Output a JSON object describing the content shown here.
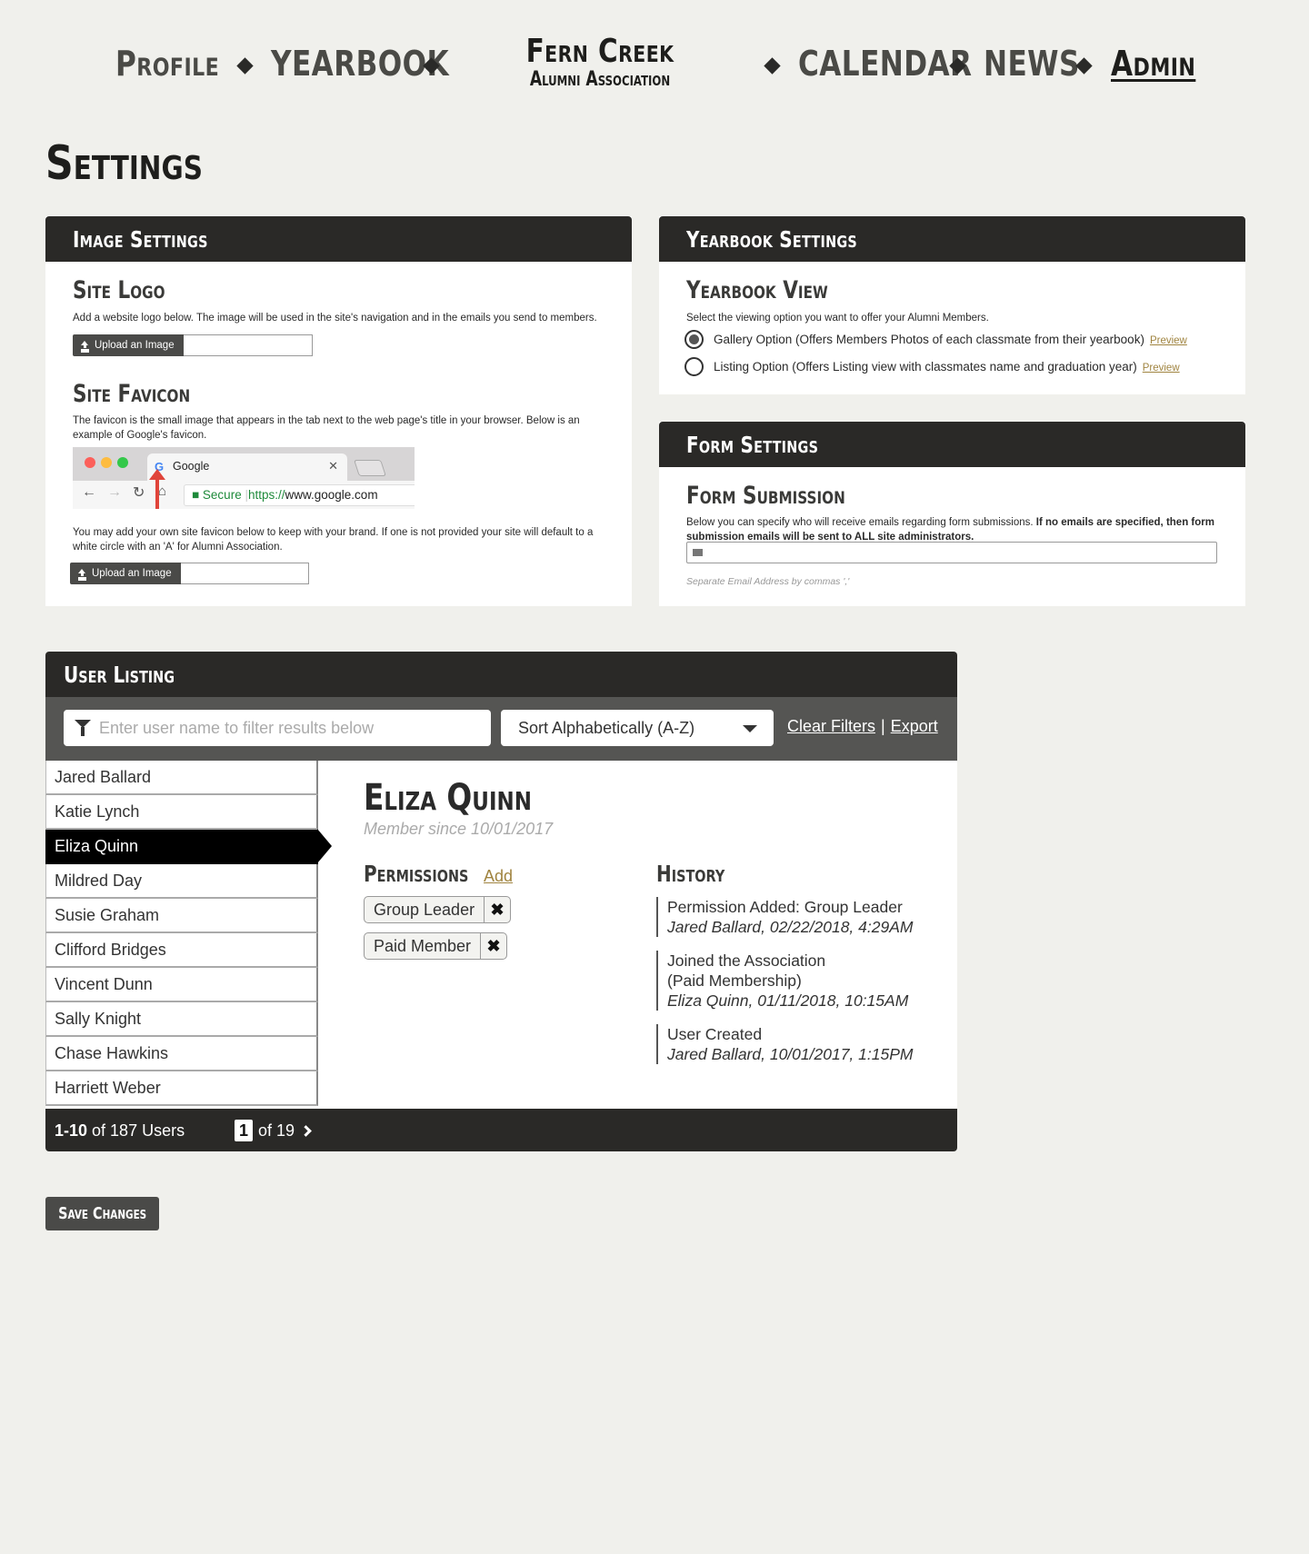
{
  "nav": {
    "left": [
      "Profile",
      "YEARBOOK"
    ],
    "brand_name": "Fern Creek",
    "brand_sub": "Alumni Association",
    "right": [
      "CALENDAR",
      "NEWS",
      "Admin"
    ]
  },
  "page": {
    "title": "Settings"
  },
  "image_settings": {
    "title": "Image Settings",
    "logo_heading": "Site Logo",
    "logo_desc": "Add a website logo below. The image will be used in the site's navigation and in the emails you send to members.",
    "upload_label": "Upload an Image",
    "favicon_heading": "Site Favicon",
    "favicon_desc": "The favicon is the small image that appears in the tab next to the web page's title in your browser. Below is an example of Google's favicon.",
    "browser_tab": "Google",
    "browser_secure": "Secure",
    "browser_url_scheme": "https://",
    "browser_url_host": "www.google.com",
    "favicon_note": "You may add your own site favicon below to keep with your brand. If one is not provided your site will default to a white circle with an 'A' for Alumni Association.",
    "upload_label_2": "Upload an Image"
  },
  "yearbook_settings": {
    "title": "Yearbook Settings",
    "view_heading": "Yearbook View",
    "view_desc": "Select the viewing option you want to offer your Alumni Members.",
    "options": [
      {
        "label": "Gallery Option (Offers Members Photos of each classmate from their yearbook)",
        "preview": "Preview",
        "selected": true
      },
      {
        "label": "Listing Option (Offers Listing view with classmates name and graduation year)",
        "preview": "Preview",
        "selected": false
      }
    ]
  },
  "form_settings": {
    "title": "Form Settings",
    "heading": "Form Submission",
    "desc_plain": "Below you can specify who will receive emails regarding form submissions. ",
    "desc_bold": "If no emails are specified, then form submission emails will be sent to ALL site administrators.",
    "email_value": "",
    "helper": "Separate Email Address by commas ','"
  },
  "user_listing": {
    "title": "User Listing",
    "filter_placeholder": "Enter user name to filter results below",
    "sort_value": "Sort Alphabetically (A-Z)",
    "clear_filters": "Clear Filters",
    "pipe": "|",
    "export": "Export",
    "users": [
      "Jared Ballard",
      "Katie Lynch",
      "Eliza Quinn",
      "Mildred Day",
      "Susie Graham",
      "Clifford Bridges",
      "Vincent Dunn",
      "Sally Knight",
      "Chase Hawkins",
      "Harriett Weber"
    ],
    "selected_index": 2,
    "detail": {
      "name": "Eliza Quinn",
      "member_since": "Member since 10/01/2017",
      "permissions_heading": "Permissions",
      "add_label": "Add",
      "permissions": [
        "Group Leader",
        "Paid Member"
      ],
      "remove_glyph": "✖",
      "history_heading": "History",
      "history": [
        {
          "event": "Permission Added: Group Leader",
          "who": "Jared Ballard, 02/22/2018, 4:29AM"
        },
        {
          "event": "Joined the Association",
          "event2": "(Paid Membership)",
          "who": "Eliza Quinn, 01/11/2018, 10:15AM"
        },
        {
          "event": "User Created",
          "who": "Jared Ballard, 10/01/2017, 1:15PM"
        }
      ]
    },
    "footer": {
      "range_bold": "1-10",
      "range_rest": " of 187 Users",
      "page": "1",
      "of_pages": "of 19"
    }
  },
  "save_label": "Save Changes",
  "colors": {
    "dark": "#2a2927",
    "accent_link": "#a08440",
    "background": "#f0f0ec"
  },
  "icons": [
    "upload-icon",
    "filter-icon",
    "chevron-down-icon",
    "chevron-right-icon",
    "envelope-icon",
    "close-icon",
    "radio-icon"
  ]
}
